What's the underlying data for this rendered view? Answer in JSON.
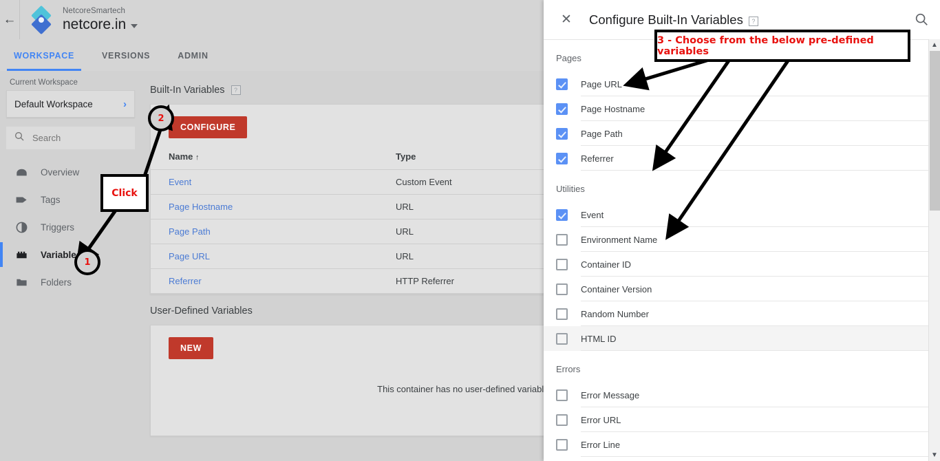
{
  "header": {
    "back_icon": "back-arrow-icon",
    "logo_icon": "gtm-logo-icon",
    "account_name": "NetcoreSmartech",
    "container_name": "netcore.in",
    "dropdown_icon": "chevron-down-icon",
    "tabs": [
      {
        "label": "WORKSPACE",
        "active": true
      },
      {
        "label": "VERSIONS",
        "active": false
      },
      {
        "label": "ADMIN",
        "active": false
      }
    ]
  },
  "sidebar": {
    "current_workspace_label": "Current Workspace",
    "workspace_name": "Default Workspace",
    "workspace_chevron": "chevron-right-icon",
    "search": {
      "placeholder": "Search",
      "icon": "search-icon",
      "value": ""
    },
    "items": [
      {
        "label": "Overview",
        "icon": "overview-icon",
        "active": false
      },
      {
        "label": "Tags",
        "icon": "tag-icon",
        "active": false
      },
      {
        "label": "Triggers",
        "icon": "trigger-icon",
        "active": false
      },
      {
        "label": "Variables",
        "icon": "variables-icon",
        "active": true
      },
      {
        "label": "Folders",
        "icon": "folder-icon",
        "active": false
      }
    ]
  },
  "main": {
    "builtin": {
      "title": "Built-In Variables",
      "help_icon": "help-icon",
      "help_label": "?",
      "configure_label": "CONFIGURE",
      "columns": [
        "Name",
        "Type"
      ],
      "sort_arrow": "↑",
      "rows": [
        {
          "name": "Event",
          "type": "Custom Event"
        },
        {
          "name": "Page Hostname",
          "type": "URL"
        },
        {
          "name": "Page Path",
          "type": "URL"
        },
        {
          "name": "Page URL",
          "type": "URL"
        },
        {
          "name": "Referrer",
          "type": "HTTP Referrer"
        }
      ]
    },
    "userdefined": {
      "title": "User-Defined Variables",
      "new_label": "NEW",
      "empty_message": "This container has no user-defined variables, click the \"New\" button to create one."
    }
  },
  "panel": {
    "close_icon": "close-icon",
    "title": "Configure Built-In Variables",
    "help_icon": "help-icon",
    "help_label": "?",
    "search_icon": "search-icon",
    "groups": [
      {
        "label": "Pages",
        "items": [
          {
            "label": "Page URL",
            "checked": true,
            "hovered": false
          },
          {
            "label": "Page Hostname",
            "checked": true,
            "hovered": false
          },
          {
            "label": "Page Path",
            "checked": true,
            "hovered": false
          },
          {
            "label": "Referrer",
            "checked": true,
            "hovered": false
          }
        ]
      },
      {
        "label": "Utilities",
        "items": [
          {
            "label": "Event",
            "checked": true,
            "hovered": false
          },
          {
            "label": "Environment Name",
            "checked": false,
            "hovered": false
          },
          {
            "label": "Container ID",
            "checked": false,
            "hovered": false
          },
          {
            "label": "Container Version",
            "checked": false,
            "hovered": false
          },
          {
            "label": "Random Number",
            "checked": false,
            "hovered": false
          },
          {
            "label": "HTML ID",
            "checked": false,
            "hovered": true
          }
        ]
      },
      {
        "label": "Errors",
        "items": [
          {
            "label": "Error Message",
            "checked": false,
            "hovered": false
          },
          {
            "label": "Error URL",
            "checked": false,
            "hovered": false
          },
          {
            "label": "Error Line",
            "checked": false,
            "hovered": false
          }
        ]
      }
    ],
    "scrollbar": {
      "up_icon": "chevron-up-icon",
      "down_icon": "chevron-down-icon"
    }
  },
  "annotations": {
    "click_callout": "Click",
    "choose_callout": "3 - Choose from the below pre-defined variables",
    "step_one": "1",
    "step_two": "2",
    "colors": {
      "accent_red": "#e8120f",
      "outline": "#000000",
      "brand_blue": "#4285f4",
      "button_red": "#c0392b",
      "checkbox_blue": "#5b91f5"
    }
  }
}
